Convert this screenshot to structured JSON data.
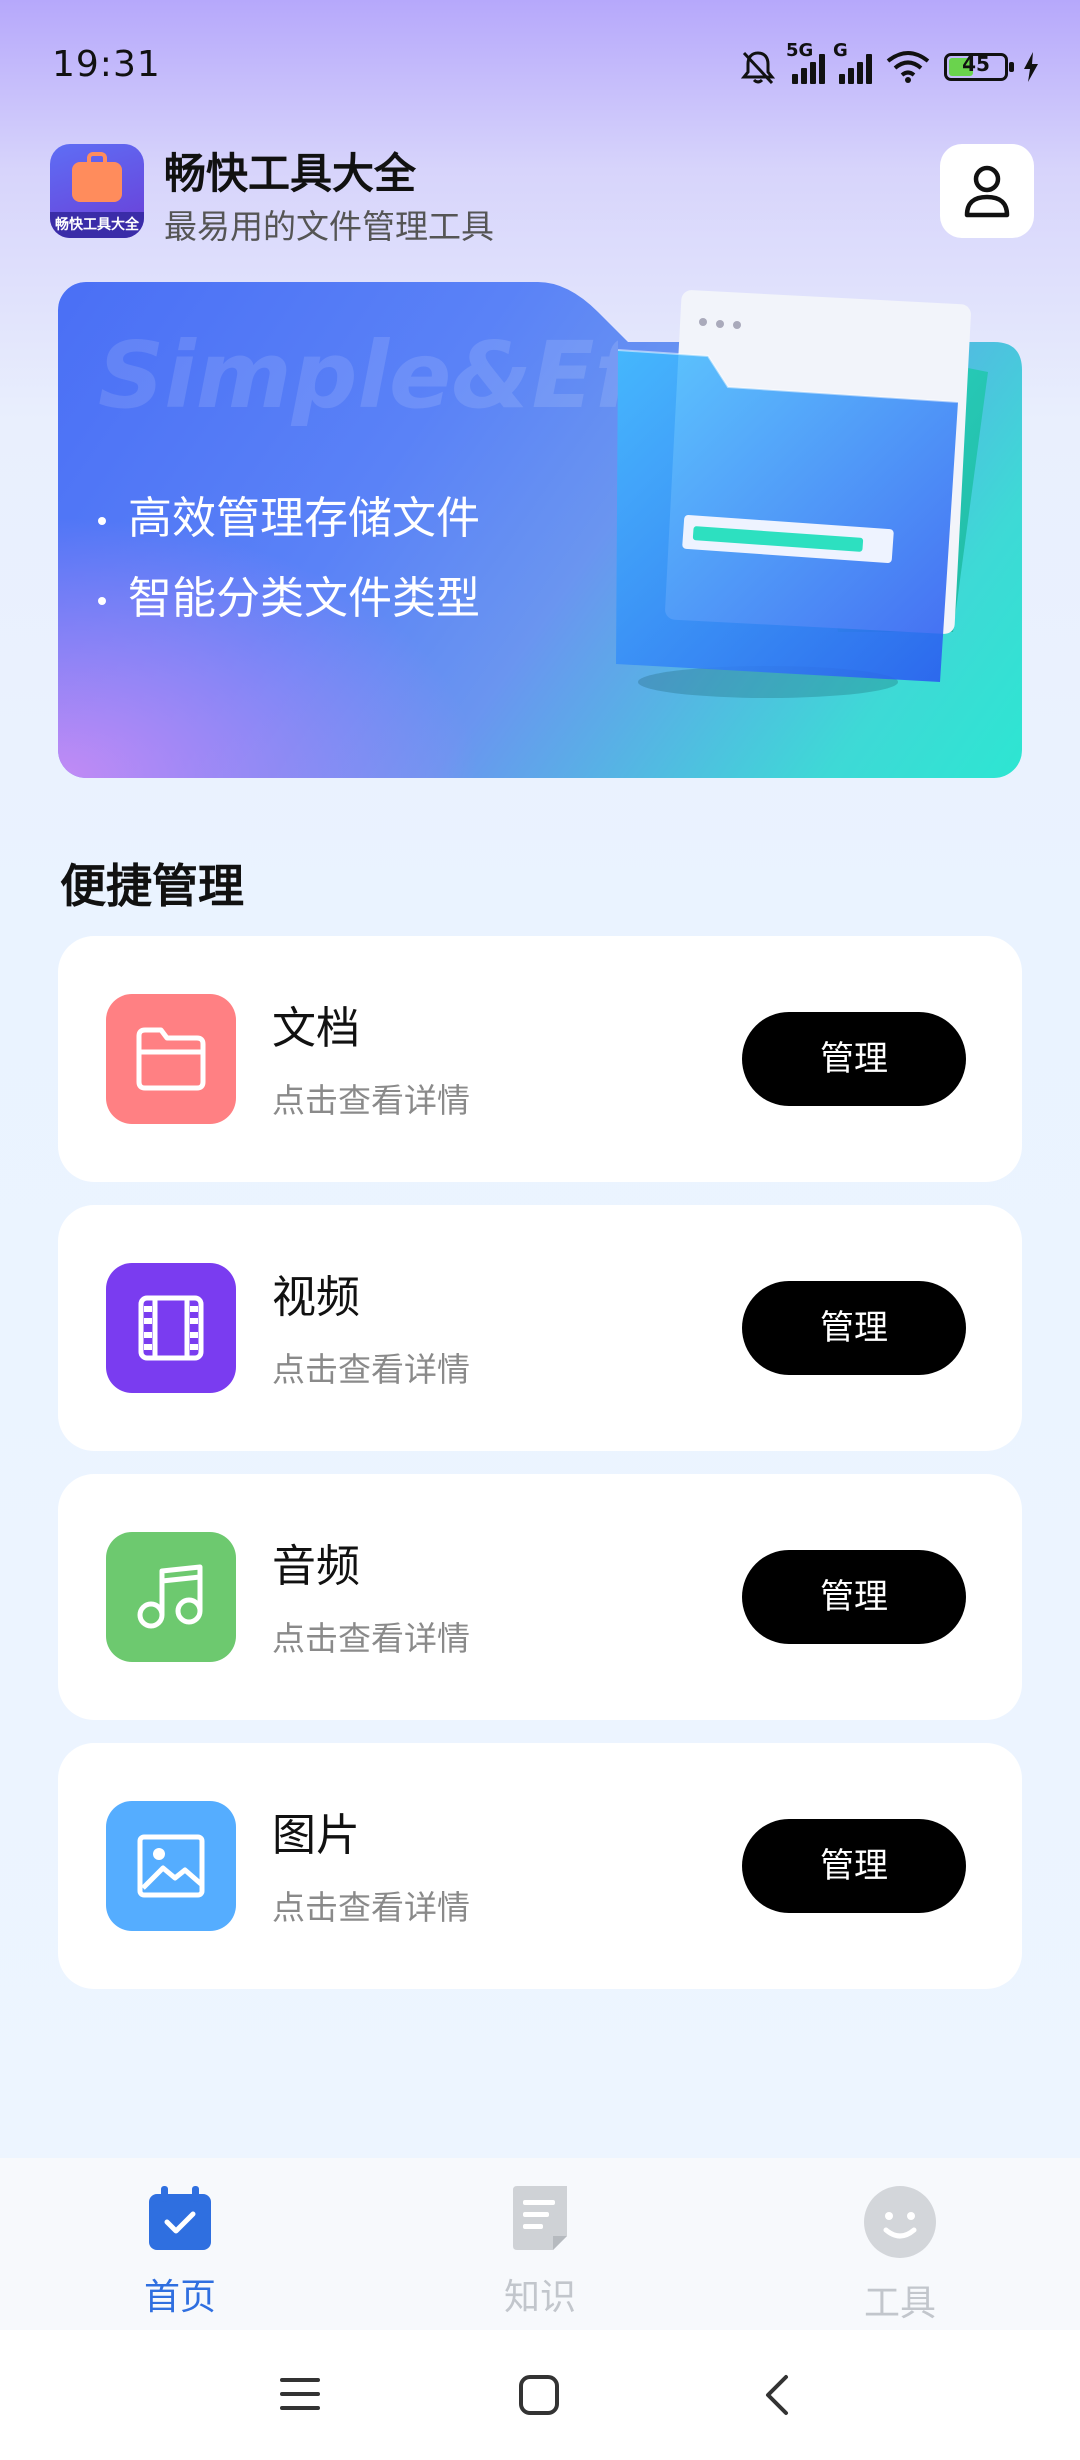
{
  "status_bar": {
    "time": "19:31",
    "battery": "45",
    "network_1": "5G",
    "network_2": "G"
  },
  "header": {
    "app_name": "畅快工具大全",
    "app_subtitle": "最易用的文件管理工具",
    "logo_caption": "畅快工具大全"
  },
  "banner": {
    "watermark": "Simple&Efficient",
    "bullets": [
      "高效管理存储文件",
      "智能分类文件类型"
    ]
  },
  "section": {
    "title": "便捷管理"
  },
  "cards": [
    {
      "title": "文档",
      "subtitle": "点击查看详情",
      "button": "管理",
      "icon": "folder-icon",
      "color": "#ff7b7b"
    },
    {
      "title": "视频",
      "subtitle": "点击查看详情",
      "button": "管理",
      "icon": "film-icon",
      "color": "#7b3ff2"
    },
    {
      "title": "音频",
      "subtitle": "点击查看详情",
      "button": "管理",
      "icon": "music-note-icon",
      "color": "#6cc76c"
    },
    {
      "title": "图片",
      "subtitle": "点击查看详情",
      "button": "管理",
      "icon": "image-icon",
      "color": "#4aa8ff"
    }
  ],
  "bottom_nav": {
    "items": [
      {
        "label": "首页",
        "icon": "calendar-check-icon",
        "active": true
      },
      {
        "label": "知识",
        "icon": "document-icon",
        "active": false
      },
      {
        "label": "工具",
        "icon": "smiley-icon",
        "active": false
      }
    ],
    "active_color": "#2f6fe0",
    "inactive_color": "#c2c6cc"
  }
}
